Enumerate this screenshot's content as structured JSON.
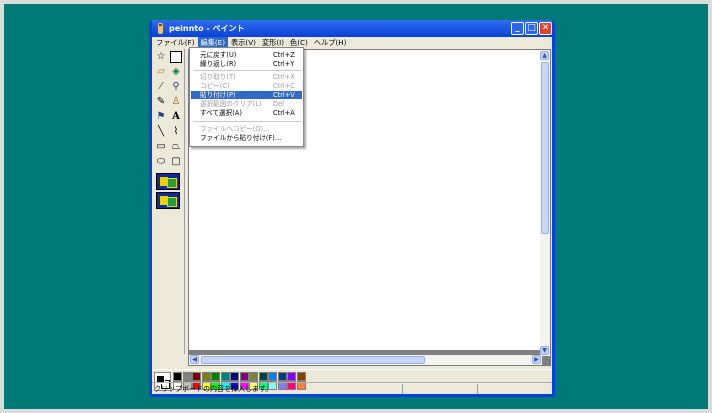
{
  "window": {
    "title": "peinnto - ペイント"
  },
  "menubar": [
    "ファイル(F)",
    "編集(E)",
    "表示(V)",
    "変形(I)",
    "色(C)",
    "ヘルプ(H)"
  ],
  "edit_menu": [
    {
      "label": "元に戻す(U)",
      "shortcut": "Ctrl+Z",
      "state": "enabled"
    },
    {
      "label": "繰り返し(R)",
      "shortcut": "Ctrl+Y",
      "state": "enabled"
    },
    {
      "label": "切り取り(T)",
      "shortcut": "Ctrl+X",
      "state": "disabled"
    },
    {
      "label": "コピー(C)",
      "shortcut": "Ctrl+C",
      "state": "disabled"
    },
    {
      "label": "貼り付け(P)",
      "shortcut": "Ctrl+V",
      "state": "highlighted"
    },
    {
      "label": "選択範囲のクリア(L)",
      "shortcut": "Del",
      "state": "disabled"
    },
    {
      "label": "すべて選択(A)",
      "shortcut": "Ctrl+A",
      "state": "enabled"
    },
    {
      "label": "ファイルへコピー(O)...",
      "shortcut": "",
      "state": "disabled"
    },
    {
      "label": "ファイルから貼り付け(F)...",
      "shortcut": "",
      "state": "enabled"
    }
  ],
  "tools": [
    {
      "name": "free-select",
      "glyph": "☆"
    },
    {
      "name": "rect-select",
      "glyph": ""
    },
    {
      "name": "eraser",
      "glyph": "▱"
    },
    {
      "name": "fill",
      "glyph": "◈"
    },
    {
      "name": "color-picker",
      "glyph": "⁄"
    },
    {
      "name": "magnifier",
      "glyph": "⚲"
    },
    {
      "name": "pencil",
      "glyph": "✎"
    },
    {
      "name": "brush",
      "glyph": "♙"
    },
    {
      "name": "airbrush",
      "glyph": "⚑"
    },
    {
      "name": "text",
      "glyph": "A"
    },
    {
      "name": "line",
      "glyph": "╲"
    },
    {
      "name": "curve",
      "glyph": "⌇"
    },
    {
      "name": "rectangle",
      "glyph": "▭"
    },
    {
      "name": "polygon",
      "glyph": "⏢"
    },
    {
      "name": "ellipse",
      "glyph": "⬭"
    },
    {
      "name": "rounded-rect",
      "glyph": "▢"
    }
  ],
  "palette": {
    "foreground": "#000000",
    "background": "#ffffff",
    "colors_top": [
      "#000000",
      "#808080",
      "#800000",
      "#808000",
      "#008000",
      "#008080",
      "#000080",
      "#800080",
      "#808040",
      "#004040",
      "#0080ff",
      "#004080",
      "#8000ff",
      "#804000"
    ],
    "colors_bottom": [
      "#ffffff",
      "#c0c0c0",
      "#ff0000",
      "#ffff00",
      "#00ff00",
      "#00ffff",
      "#0000ff",
      "#ff00ff",
      "#ffff80",
      "#00ff80",
      "#80ffff",
      "#8080ff",
      "#ff0080",
      "#ff8040"
    ]
  },
  "status": {
    "text": "クリップボードの内容を挿入します。"
  }
}
